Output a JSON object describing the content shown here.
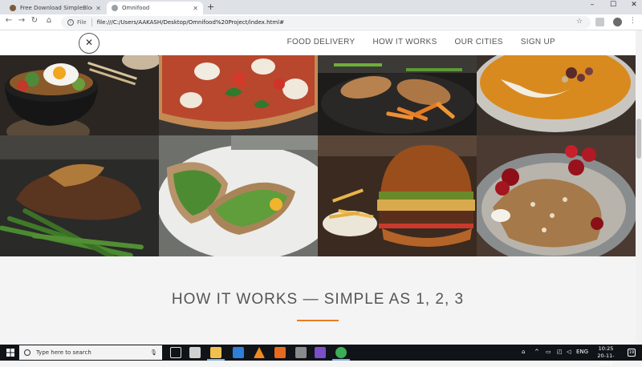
{
  "browser": {
    "tabs": [
      {
        "title": "Free Download SimpleBlogging T",
        "active": false,
        "favicon_color": "#7a5c3c"
      },
      {
        "title": "Omnifood",
        "active": true,
        "favicon_color": "#9aa0a6"
      }
    ],
    "address": {
      "scheme_label": "File",
      "url": "file:///C:/Users/AAKASH/Desktop/Omnifood%20Project/index.html#"
    },
    "window_controls": [
      "–",
      "☐",
      "✕"
    ]
  },
  "site": {
    "nav": {
      "logo_icon": "fork-knife-icon",
      "links": [
        "FOOD DELIVERY",
        "HOW IT WORKS",
        "OUR CITIES",
        "SIGN UP"
      ]
    },
    "section": {
      "title": "HOW IT WORKS — SIMPLE AS 1, 2, 3",
      "accent_color": "#e67e22"
    }
  },
  "taskbar": {
    "search_placeholder": "Type here to search",
    "tray_lang": "ENG",
    "time": "10:25",
    "date": "20-11-2018",
    "notifications": "19"
  }
}
